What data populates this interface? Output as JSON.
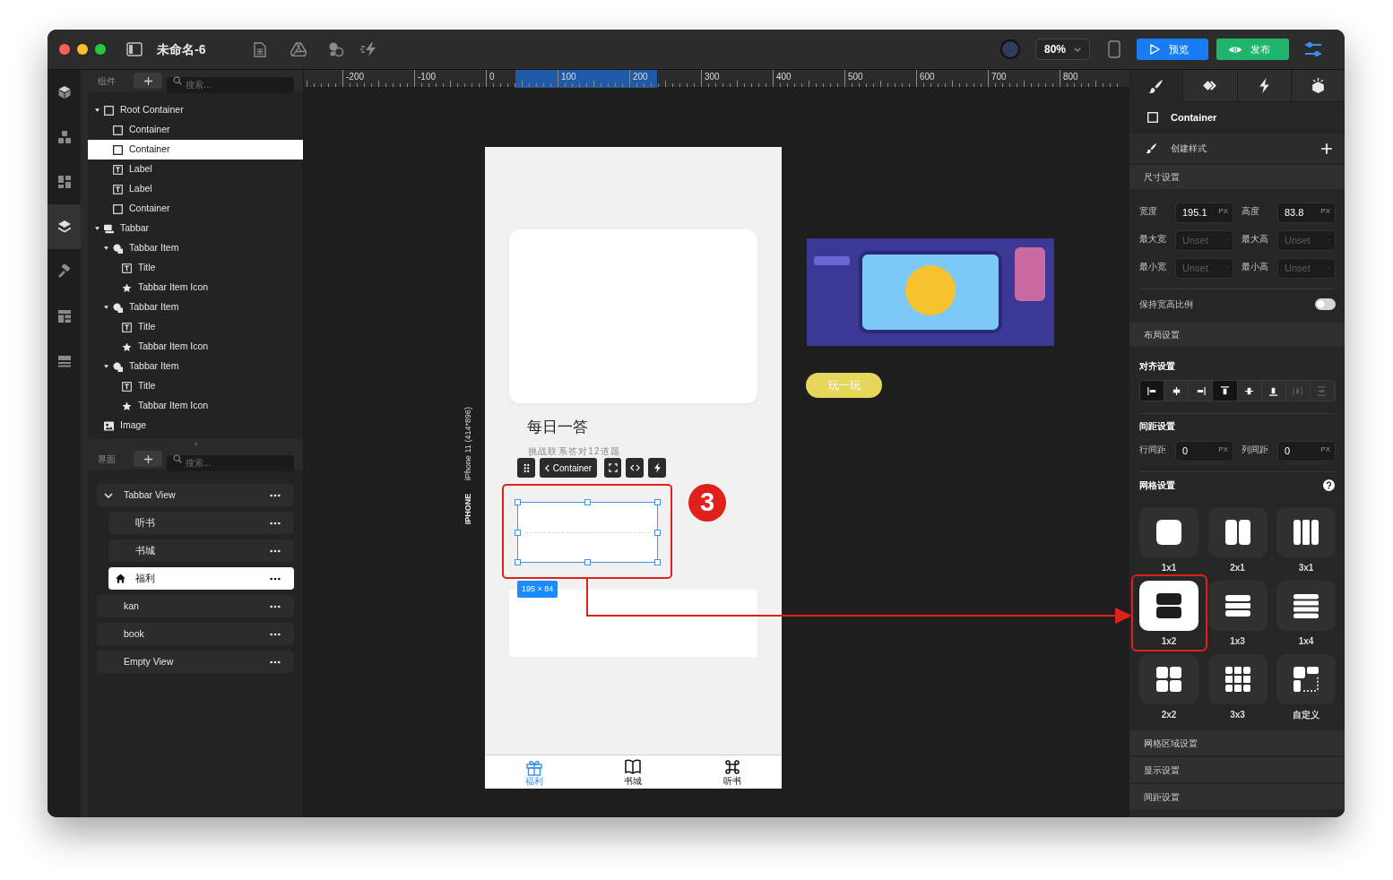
{
  "window": {
    "title": "未命名-6",
    "zoom": "80%",
    "preview": "预览",
    "publish": "发布"
  },
  "rail": [
    {
      "kind": "cube",
      "selected": false
    },
    {
      "kind": "blocks",
      "selected": false
    },
    {
      "kind": "dashboard",
      "selected": false
    },
    {
      "kind": "layers",
      "selected": true
    },
    {
      "kind": "hammer",
      "selected": false
    },
    {
      "kind": "layout",
      "selected": false
    },
    {
      "kind": "rows",
      "selected": false
    }
  ],
  "components_panel": {
    "title": "组件",
    "search": {
      "placeholder": "搜索..."
    },
    "tree": [
      {
        "label": "Root Container",
        "kind": "container",
        "expanded": true,
        "selected": false,
        "children": [
          {
            "label": "Container",
            "kind": "container",
            "selected": false
          },
          {
            "label": "Container",
            "kind": "container",
            "selected": true
          },
          {
            "label": "Label",
            "kind": "label",
            "selected": false
          },
          {
            "label": "Label",
            "kind": "label",
            "selected": false
          },
          {
            "label": "Container",
            "kind": "container",
            "selected": false
          }
        ]
      },
      {
        "label": "Tabbar",
        "kind": "tabbar",
        "expanded": true,
        "selected": false,
        "children": [
          {
            "label": "Tabbar Item",
            "kind": "item",
            "expanded": true,
            "selected": false,
            "children": [
              {
                "label": "Title",
                "kind": "label",
                "selected": false
              },
              {
                "label": "Tabbar Item Icon",
                "kind": "icon",
                "selected": false
              }
            ]
          },
          {
            "label": "Tabbar Item",
            "kind": "item",
            "expanded": true,
            "selected": false,
            "children": [
              {
                "label": "Title",
                "kind": "label",
                "selected": false
              },
              {
                "label": "Tabbar Item Icon",
                "kind": "icon",
                "selected": false
              }
            ]
          },
          {
            "label": "Tabbar Item",
            "kind": "item",
            "expanded": true,
            "selected": false,
            "children": [
              {
                "label": "Title",
                "kind": "label",
                "selected": false
              },
              {
                "label": "Tabbar Item Icon",
                "kind": "icon",
                "selected": false
              }
            ]
          }
        ]
      },
      {
        "label": "Image",
        "kind": "image",
        "selected": false
      }
    ]
  },
  "pages_panel": {
    "title": "界面",
    "search": {
      "placeholder": "搜索..."
    },
    "pages": [
      {
        "label": "Tabbar View",
        "expanded": true,
        "selected": false,
        "children": [
          {
            "label": "听书",
            "home": false,
            "selected": false
          },
          {
            "label": "书城",
            "home": false,
            "selected": false
          },
          {
            "label": "福利",
            "home": true,
            "selected": true
          }
        ]
      },
      {
        "label": "kan",
        "selected": false
      },
      {
        "label": "book",
        "selected": false
      },
      {
        "label": "Empty View",
        "selected": false
      }
    ]
  },
  "ruler": {
    "labels": [
      "-200",
      "-100",
      "0",
      "100",
      "200",
      "300",
      "400",
      "500",
      "600",
      "700",
      "800"
    ]
  },
  "canvas": {
    "device_model": "iPhone 11 (414*896)",
    "device_type": "IPHONE",
    "screen": {
      "title": "每日一答",
      "subtitle": "挑战联系答对12道题",
      "toolbar_label": "Container",
      "size_badge": "195 × 84",
      "step_number": "3",
      "tabbar": [
        {
          "label": "福利",
          "kind": "gift",
          "selected": true
        },
        {
          "label": "书城",
          "kind": "book",
          "selected": false
        },
        {
          "label": "听书",
          "kind": "command",
          "selected": false
        }
      ]
    },
    "play_button": "玩一玩"
  },
  "inspector": {
    "tabs": [
      {
        "kind": "brush",
        "selected": true
      },
      {
        "kind": "diamonds",
        "selected": false
      },
      {
        "kind": "bolt",
        "selected": false
      },
      {
        "kind": "box",
        "selected": false
      }
    ],
    "component": "Container",
    "create_style": "创建样式",
    "size_title": "尺寸设置",
    "size_fields": [
      {
        "label": "宽度",
        "value": "195.1",
        "unit": "PX"
      },
      {
        "label": "高度",
        "value": "83.8",
        "unit": "PX"
      },
      {
        "label": "最大宽",
        "placeholder": "Unset",
        "unit": "-"
      },
      {
        "label": "最大高",
        "placeholder": "Unset",
        "unit": "-"
      },
      {
        "label": "最小宽",
        "placeholder": "Unset",
        "unit": "-"
      },
      {
        "label": "最小高",
        "placeholder": "Unset",
        "unit": "-"
      }
    ],
    "keep_ratio": {
      "label": "保持宽高比例",
      "on": false
    },
    "layout_title": "布局设置",
    "align_title": "对齐设置",
    "align_buttons": [
      {
        "kind": "left",
        "selected": true,
        "disabled": false
      },
      {
        "kind": "center",
        "selected": false,
        "disabled": false
      },
      {
        "kind": "right",
        "selected": false,
        "disabled": false
      },
      {
        "kind": "top",
        "selected": true,
        "disabled": false
      },
      {
        "kind": "middle",
        "selected": false,
        "disabled": false
      },
      {
        "kind": "bottom",
        "selected": false,
        "disabled": false
      },
      {
        "kind": "spreadx",
        "selected": false,
        "disabled": true
      },
      {
        "kind": "spready",
        "selected": false,
        "disabled": true
      }
    ],
    "spacing_title": "间距设置",
    "spacing_fields": [
      {
        "label": "行间距",
        "value": "0",
        "unit": "PX"
      },
      {
        "label": "列间距",
        "value": "0",
        "unit": "PX"
      }
    ],
    "grid_title": "网格设置",
    "grid_options": [
      {
        "label": "1x1",
        "kind": "single",
        "selected": false,
        "annotated": false
      },
      {
        "label": "2x1",
        "kind": "cols2",
        "selected": false,
        "annotated": false
      },
      {
        "label": "3x1",
        "kind": "cols3",
        "selected": false,
        "annotated": false
      },
      {
        "label": "1x2",
        "kind": "rows2",
        "selected": true,
        "annotated": true
      },
      {
        "label": "1x3",
        "kind": "rows3",
        "selected": false,
        "annotated": false
      },
      {
        "label": "1x4",
        "kind": "rows4",
        "selected": false,
        "annotated": false
      },
      {
        "label": "2x2",
        "kind": "quad",
        "selected": false,
        "annotated": false
      },
      {
        "label": "3x3",
        "kind": "nine",
        "selected": false,
        "annotated": false
      },
      {
        "label": "自定义",
        "kind": "custom",
        "selected": false,
        "annotated": false
      }
    ],
    "sections": [
      "网格区域设置",
      "显示设置",
      "间距设置"
    ]
  }
}
